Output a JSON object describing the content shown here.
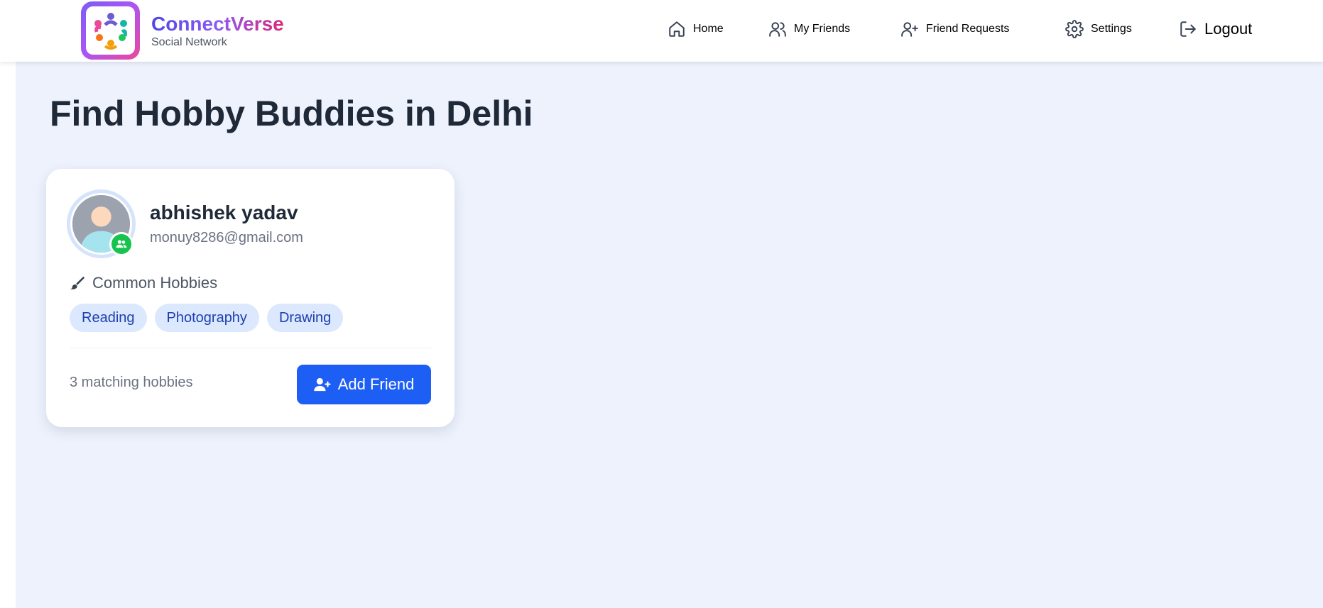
{
  "header": {
    "brand_title": "ConnectVerse",
    "brand_subtitle": "Social Network",
    "nav": {
      "home": "Home",
      "friends": "My Friends",
      "requests": "Friend Requests",
      "settings": "Settings",
      "logout": "Logout"
    }
  },
  "page": {
    "title": "Find Hobby Buddies in Delhi"
  },
  "card": {
    "name": "abhishek yadav",
    "email": "monuy8286@gmail.com",
    "hobbies_heading": "Common Hobbies",
    "hobbies": [
      "Reading",
      "Photography",
      "Drawing"
    ],
    "match_text": "3 matching hobbies",
    "add_button": "Add Friend"
  },
  "colors": {
    "accent": "#1d5ef5",
    "background": "#edf2fd",
    "badge": "#16c44d"
  },
  "icons": {
    "home": "home-icon",
    "friends": "users-icon",
    "requests": "user-plus-icon",
    "settings": "gear-icon",
    "logout": "logout-icon",
    "hobbies": "paintbrush-icon"
  }
}
